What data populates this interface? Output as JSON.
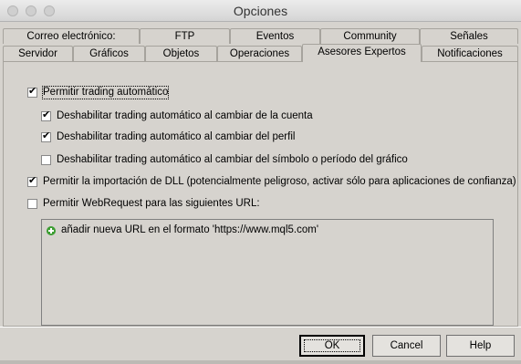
{
  "window": {
    "title": "Opciones"
  },
  "tabs_row1": [
    {
      "label": "Correo electrónico:"
    },
    {
      "label": "FTP"
    },
    {
      "label": "Eventos"
    },
    {
      "label": "Community"
    },
    {
      "label": "Señales"
    }
  ],
  "tabs_row2": [
    {
      "label": "Servidor"
    },
    {
      "label": "Gráficos"
    },
    {
      "label": "Objetos"
    },
    {
      "label": "Operaciones"
    },
    {
      "label": "Asesores Expertos",
      "active": true
    },
    {
      "label": "Notificaciones"
    }
  ],
  "options": {
    "auto_trading": {
      "label": "Permitir trading automático",
      "checked": true
    },
    "disable_on_account": {
      "label": "Deshabilitar trading automático al cambiar de la cuenta",
      "checked": true
    },
    "disable_on_profile": {
      "label": "Deshabilitar trading automático al cambiar del perfil",
      "checked": true
    },
    "disable_on_symbol": {
      "label": "Deshabilitar trading automático al cambiar del símbolo o período del gráfico",
      "checked": false
    },
    "dll_import": {
      "label": "Permitir la importación de DLL (potencialmente peligroso, activar sólo para aplicaciones de confianza)",
      "checked": true
    },
    "webrequest": {
      "label": "Permitir WebRequest para las siguientes URL:",
      "checked": false
    }
  },
  "url_list": {
    "add_label": "añadir nueva URL en el formato 'https://www.mql5.com'"
  },
  "buttons": {
    "ok": "OK",
    "cancel": "Cancel",
    "help": "Help"
  }
}
